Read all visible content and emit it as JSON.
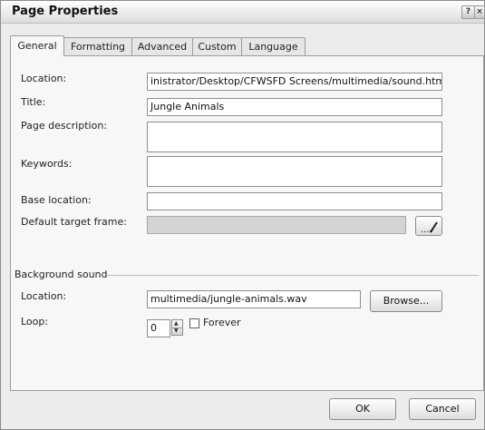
{
  "window": {
    "title": "Page Properties",
    "help_glyph": "?",
    "close_glyph": "×"
  },
  "tabs": [
    {
      "label": "General",
      "active": true
    },
    {
      "label": "Formatting",
      "active": false
    },
    {
      "label": "Advanced",
      "active": false
    },
    {
      "label": "Custom",
      "active": false
    },
    {
      "label": "Language",
      "active": false
    }
  ],
  "general": {
    "location_label": "Location:",
    "location_value": "inistrator/Desktop/CFWSFD Screens/multimedia/sound.htm",
    "title_label": "Title:",
    "title_value": "Jungle Animals",
    "description_label": "Page description:",
    "description_value": "",
    "keywords_label": "Keywords:",
    "keywords_value": "",
    "base_location_label": "Base location:",
    "base_location_value": "",
    "target_frame_label": "Default target frame:",
    "target_frame_value": "",
    "target_frame_icon": "pencil-icon"
  },
  "background_sound": {
    "group_label": "Background sound",
    "location_label": "Location:",
    "location_value": "multimedia/jungle-animals.wav",
    "browse_label": "Browse...",
    "loop_label": "Loop:",
    "loop_value": "0",
    "forever_label": "Forever",
    "forever_checked": false
  },
  "footer": {
    "ok_label": "OK",
    "cancel_label": "Cancel"
  }
}
